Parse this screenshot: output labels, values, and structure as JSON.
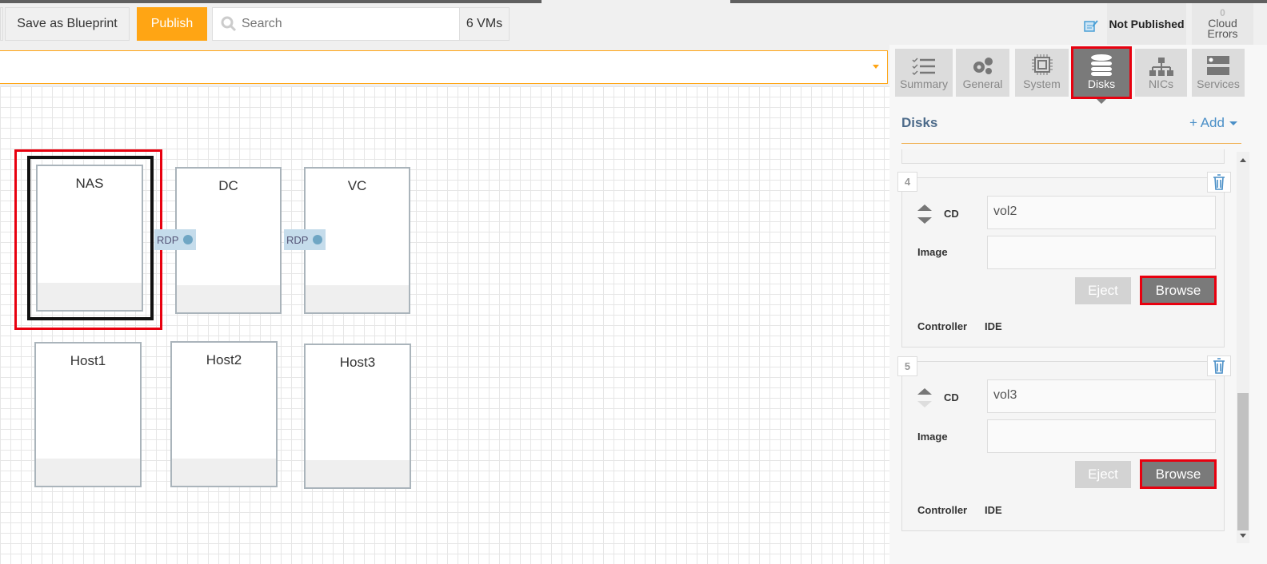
{
  "toolbar": {
    "save_blueprint": "Save as Blueprint",
    "publish": "Publish",
    "search_placeholder": "Search",
    "vm_count": "6 VMs",
    "status": "Not Published",
    "cloud_errors_count": "0",
    "cloud_errors_label1": "Cloud",
    "cloud_errors_label2": "Errors"
  },
  "colors": {
    "accent": "#ffa514",
    "highlight": "#e8000f",
    "tab_active": "#7a7a7a",
    "link": "#4a8fc7"
  },
  "canvas": {
    "vms": [
      {
        "name": "NAS",
        "selected": true
      },
      {
        "name": "DC"
      },
      {
        "name": "VC"
      },
      {
        "name": "Host1"
      },
      {
        "name": "Host2"
      },
      {
        "name": "Host3"
      }
    ],
    "connectors": [
      "RDP",
      "RDP"
    ]
  },
  "tabs": [
    {
      "label": "Summary",
      "icon": "checklist-icon"
    },
    {
      "label": "General",
      "icon": "gears-icon"
    },
    {
      "label": "System",
      "icon": "chip-icon"
    },
    {
      "label": "Disks",
      "icon": "database-icon",
      "active": true
    },
    {
      "label": "NICs",
      "icon": "network-icon"
    },
    {
      "label": "Services",
      "icon": "server-icon"
    }
  ],
  "disks": {
    "title": "Disks",
    "add": "+ Add",
    "items": [
      {
        "index": "4",
        "type": "CD",
        "name": "vol2",
        "image_label": "Image",
        "image": "",
        "eject": "Eject",
        "browse": "Browse",
        "controller_label": "Controller",
        "controller": "IDE"
      },
      {
        "index": "5",
        "type": "CD",
        "name": "vol3",
        "image_label": "Image",
        "image": "",
        "eject": "Eject",
        "browse": "Browse",
        "controller_label": "Controller",
        "controller": "IDE"
      }
    ]
  }
}
